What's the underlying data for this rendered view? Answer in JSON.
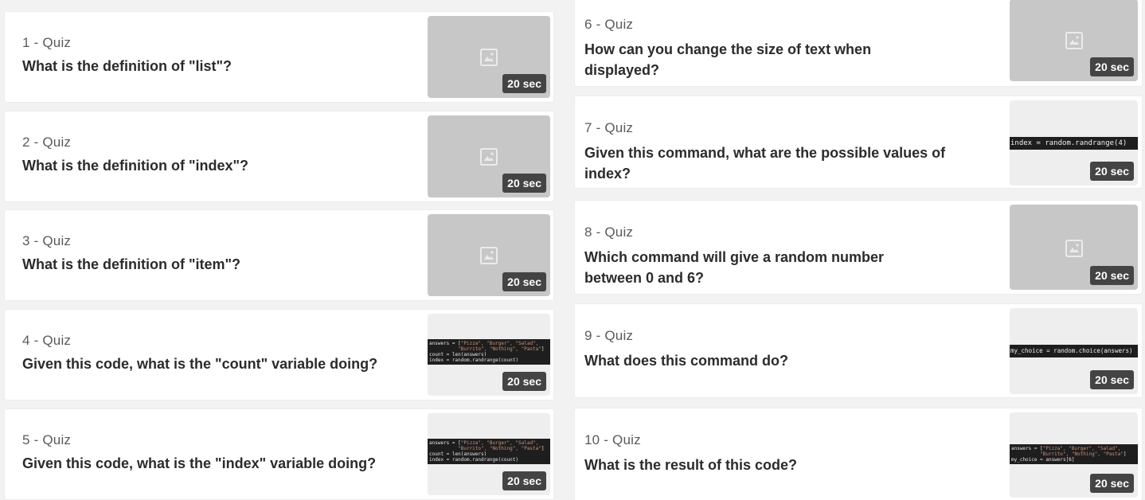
{
  "duration_badge": "20 sec",
  "colors": {
    "page_bg": "#f2f2f2",
    "card_bg": "#ffffff",
    "placeholder_bg": "#c7c7c7",
    "badge_bg": "#444444",
    "code_bg": "#1e1e1e"
  },
  "questions": [
    {
      "meta": "1 - Quiz",
      "question": "What is the definition of \"list\"?",
      "thumbnail": "image-placeholder-icon"
    },
    {
      "meta": "2 - Quiz",
      "question": "What is the definition of \"index\"?",
      "thumbnail": "image-placeholder-icon"
    },
    {
      "meta": "3 - Quiz",
      "question": "What is the definition of \"item\"?",
      "thumbnail": "image-placeholder-icon"
    },
    {
      "meta": "4 - Quiz",
      "question": "Given this code, what is the \"count\" variable doing?",
      "thumbnail": "code-image",
      "code": {
        "l1a": "answers = [",
        "l1s": "\"Pizza\", \"Burger\", \"Salad\",",
        "l2s": "          \"Burrito\", \"Nothing\", \"Pasta\"",
        "l2b": "]",
        "l3": "count = len(answers)",
        "l4": "index = random.randrange(count)"
      }
    },
    {
      "meta": "5 - Quiz",
      "question": "Given this code, what is the \"index\" variable doing?",
      "thumbnail": "code-image",
      "code": {
        "l1a": "answers = [",
        "l1s": "\"Pizza\", \"Burger\", \"Salad\",",
        "l2s": "          \"Burrito\", \"Nothing\", \"Pasta\"",
        "l2b": "]",
        "l3": "count = len(answers)",
        "l4": "index = random.randrange(count)"
      }
    },
    {
      "meta": "6 - Quiz",
      "question": "How can you change the size of text when displayed?",
      "thumbnail": "image-placeholder-icon"
    },
    {
      "meta": "7 - Quiz",
      "question": "Given this command, what are the possible values of index?",
      "thumbnail": "code-image",
      "code_line": "index = random.randrange(4)"
    },
    {
      "meta": "8 - Quiz",
      "question": "Which command will give a random number between 0 and 6?",
      "thumbnail": "image-placeholder-icon"
    },
    {
      "meta": "9 - Quiz",
      "question": "What does this command do?",
      "thumbnail": "code-image",
      "code_line": "my_choice = random.choice(answers)"
    },
    {
      "meta": "10 - Quiz",
      "question": "What is the result of this code?",
      "thumbnail": "code-image",
      "code": {
        "l1a": "answers = [",
        "l1s": "\"Pizza\", \"Burger\", \"Salad\",",
        "l2s": "          \"Burrito\", \"Nothing\", \"Pasta\"",
        "l2b": "]",
        "l3": "my_choice = answers[6]",
        "l4": ""
      }
    }
  ]
}
